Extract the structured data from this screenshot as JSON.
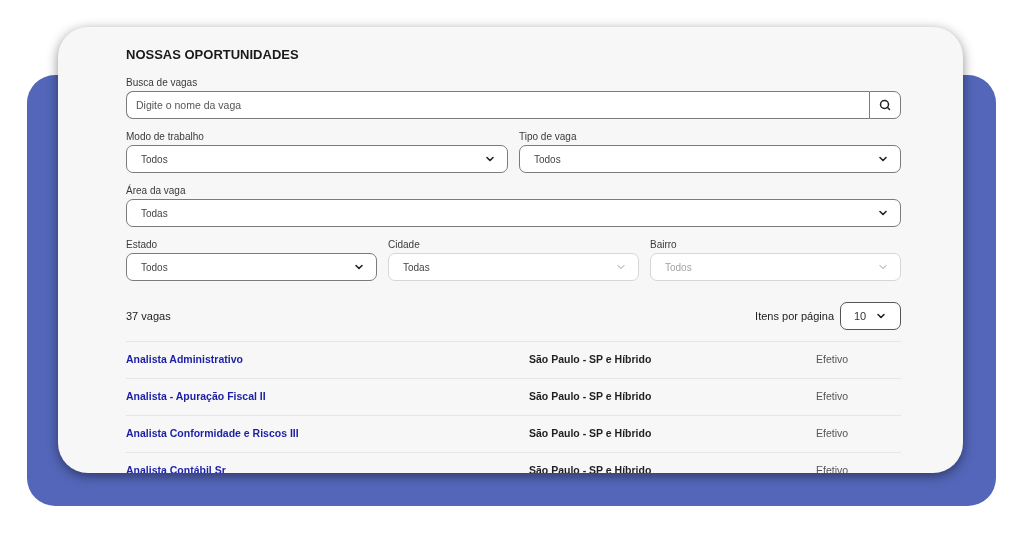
{
  "section": {
    "title": "NOSSAS OPORTUNIDADES"
  },
  "search": {
    "label": "Busca de vagas",
    "placeholder": "Digite o nome da vaga"
  },
  "filter_rows": [
    [
      {
        "label": "Modo de trabalho",
        "value": "Todos",
        "disabled": false
      },
      {
        "label": "Tipo de vaga",
        "value": "Todos",
        "disabled": false
      }
    ],
    [
      {
        "label": "Área da vaga",
        "value": "Todas",
        "disabled": false
      }
    ],
    [
      {
        "label": "Estado",
        "value": "Todos",
        "disabled": false
      },
      {
        "label": "Cidade",
        "value": "Todas",
        "disabled": true
      },
      {
        "label": "Bairro",
        "placeholder": "Todos",
        "disabled": true
      }
    ]
  ],
  "results": {
    "count": "37 vagas",
    "per_page_label": "Itens por página",
    "per_page_value": "10"
  },
  "jobs": [
    {
      "title": "Analista Administrativo",
      "location": "São Paulo - SP e Híbrido",
      "type": "Efetivo"
    },
    {
      "title": "Analista - Apuração Fiscal II",
      "location": "São Paulo - SP e Híbrido",
      "type": "Efetivo"
    },
    {
      "title": "Analista Conformidade e Riscos III",
      "location": "São Paulo - SP e Híbrido",
      "type": "Efetivo"
    },
    {
      "title": "Analista Contábil Sr",
      "location": "São Paulo - SP e Híbrido",
      "type": "Efetivo"
    }
  ]
}
